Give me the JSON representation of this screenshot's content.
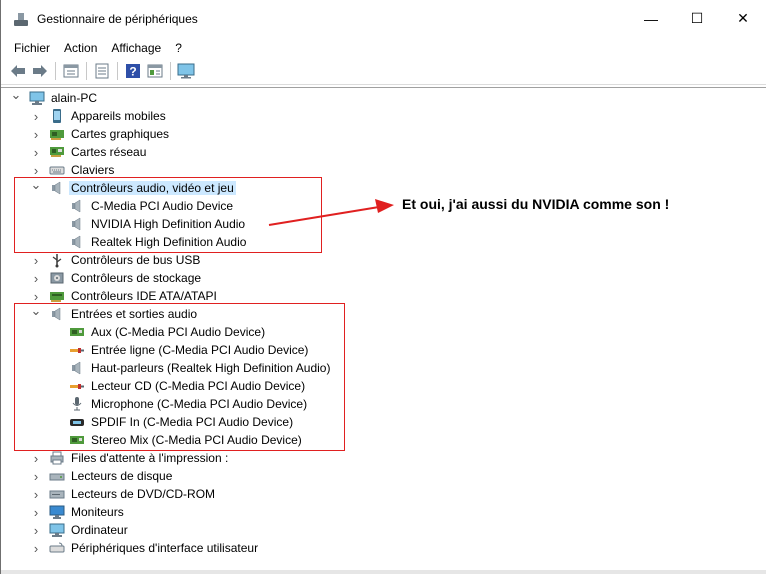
{
  "window": {
    "title": "Gestionnaire de périphériques",
    "minimize": "—",
    "maximize": "☐",
    "close": "✕"
  },
  "menu": [
    "Fichier",
    "Action",
    "Affichage",
    "?"
  ],
  "toolbar": [
    "back-icon",
    "forward-icon",
    "properties-icon",
    "devices-icon",
    "help-icon",
    "view-icon",
    "monitor-scan-icon"
  ],
  "tree": {
    "root": "alain-PC",
    "items": [
      {
        "label": "Appareils mobiles",
        "icon": "phone-icon"
      },
      {
        "label": "Cartes graphiques",
        "icon": "display-adapter-icon"
      },
      {
        "label": "Cartes réseau",
        "icon": "network-icon"
      },
      {
        "label": "Claviers",
        "icon": "keyboard-icon"
      },
      {
        "label": "Contrôleurs audio, vidéo et jeu",
        "icon": "speaker-icon",
        "expanded": true,
        "selected": true,
        "children": [
          "C-Media PCI Audio Device",
          "NVIDIA High Definition Audio",
          "Realtek High Definition Audio"
        ]
      },
      {
        "label": "Contrôleurs de bus USB",
        "icon": "usb-icon"
      },
      {
        "label": "Contrôleurs de stockage",
        "icon": "storage-icon"
      },
      {
        "label": "Contrôleurs IDE ATA/ATAPI",
        "icon": "ide-icon"
      },
      {
        "label": "Entrées et sorties audio",
        "icon": "speaker-icon",
        "expanded": true,
        "children": [
          "Aux (C-Media PCI Audio Device)",
          "Entrée ligne (C-Media PCI Audio Device)",
          "Haut-parleurs (Realtek High Definition Audio)",
          "Lecteur CD (C-Media PCI Audio Device)",
          "Microphone (C-Media PCI Audio Device)",
          "SPDIF In (C-Media PCI Audio Device)",
          "Stereo Mix (C-Media PCI Audio Device)"
        ]
      },
      {
        "label": "Files d'attente à l'impression :",
        "icon": "printer-icon"
      },
      {
        "label": "Lecteurs de disque",
        "icon": "disk-icon"
      },
      {
        "label": "Lecteurs de DVD/CD-ROM",
        "icon": "dvd-icon"
      },
      {
        "label": "Moniteurs",
        "icon": "monitor-icon"
      },
      {
        "label": "Ordinateur",
        "icon": "computer-icon"
      },
      {
        "label": "Périphériques d'interface utilisateur",
        "icon": "hid-icon"
      }
    ]
  },
  "annotation": {
    "text": "Et oui, j'ai aussi du NVIDIA comme son !",
    "color": "#e02020"
  }
}
